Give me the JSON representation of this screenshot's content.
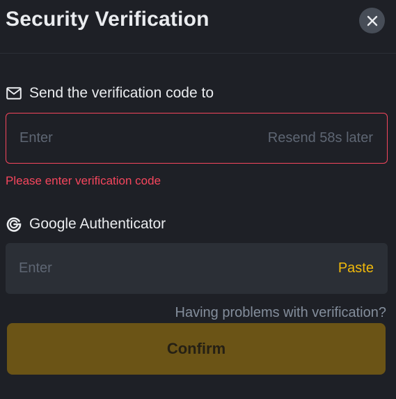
{
  "header": {
    "title": "Security Verification",
    "close_icon": "close-icon"
  },
  "email_section": {
    "label": "Send the verification code to",
    "icon": "mail-icon",
    "input_placeholder": "Enter",
    "resend_text": "Resend 58s later",
    "error_message": "Please enter verification code"
  },
  "authenticator_section": {
    "label": "Google Authenticator",
    "icon": "google-authenticator-icon",
    "input_placeholder": "Enter",
    "paste_label": "Paste"
  },
  "help_link": "Having problems with verification?",
  "confirm_label": "Confirm",
  "colors": {
    "background": "#1e2026",
    "input_background": "#2b2f36",
    "error": "#f6465d",
    "accent": "#f0b90b",
    "confirm_disabled": "#6b5416",
    "muted_text": "#5e6673"
  }
}
